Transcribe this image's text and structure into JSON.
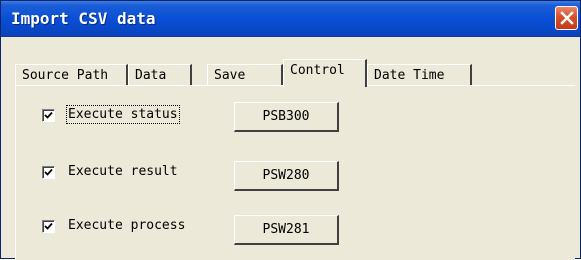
{
  "window": {
    "title": "Import CSV data",
    "close_icon": "close-icon"
  },
  "tabs": [
    {
      "label": "Source Path",
      "active": false
    },
    {
      "label": "Data",
      "active": false
    },
    {
      "label": "Save",
      "active": false
    },
    {
      "label": "Control",
      "active": true
    },
    {
      "label": "Date Time",
      "active": false
    }
  ],
  "control": {
    "rows": [
      {
        "label": "Execute status",
        "checked": true,
        "button": "PSB300"
      },
      {
        "label": "Execute result",
        "checked": true,
        "button": "PSW280"
      },
      {
        "label": "Execute process",
        "checked": true,
        "button": "PSW281"
      }
    ]
  }
}
